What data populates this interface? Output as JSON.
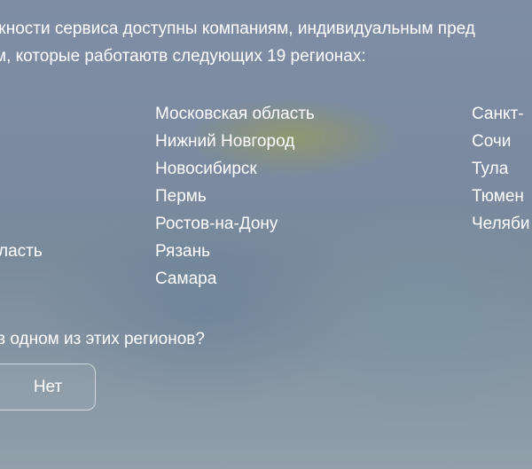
{
  "intro": {
    "line1": "жности сервиса доступны компаниям, индивидуальным пред",
    "line2": "м, которые работаютв следующих 19 регионах:"
  },
  "regions": {
    "column0": [
      "ласть"
    ],
    "column1": [
      "Московская область",
      "Нижний Новгород",
      "Новосибирск",
      "Пермь",
      "Ростов-на-Дону",
      "Рязань",
      "Самара"
    ],
    "column2": [
      "Санкт-",
      "Сочи",
      "Тула",
      "Тюмен",
      "Челяби"
    ]
  },
  "question": "в одном из этих регионов?",
  "buttons": {
    "no_label": "Нет"
  }
}
